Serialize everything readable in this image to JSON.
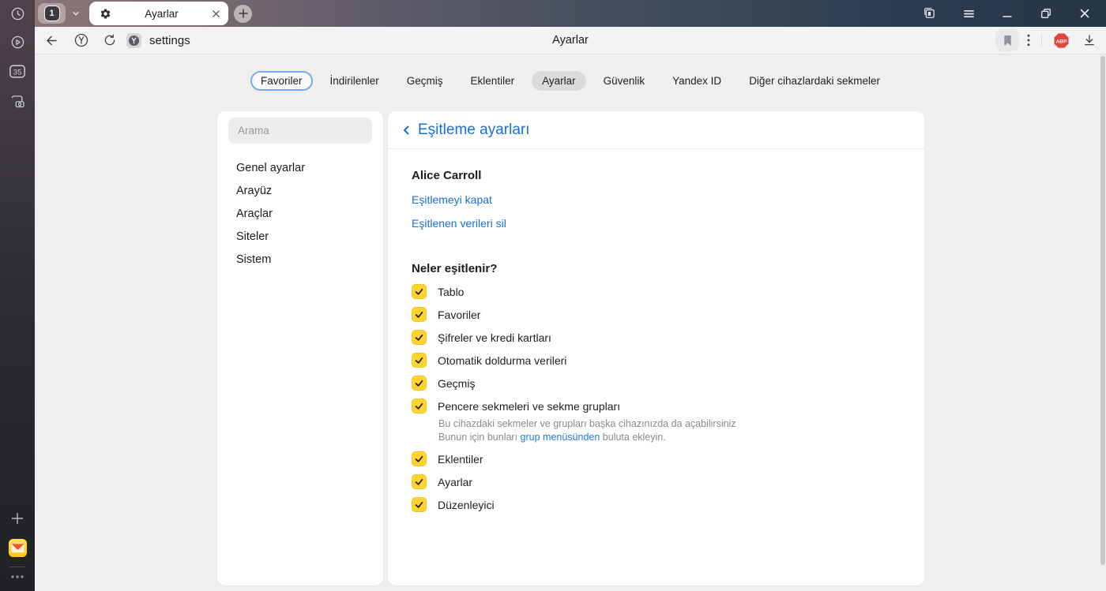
{
  "theme": {
    "accent_blue": "#1670d9",
    "checkbox_yellow": "#ffd42e",
    "abp_red": "#e2453c"
  },
  "rail": {
    "counter_badge": "35"
  },
  "tabstrip": {
    "group_count": "1",
    "tab_title": "Ayarlar"
  },
  "toolbar": {
    "url": "settings",
    "page_title": "Ayarlar",
    "adblock_badge": "ABP"
  },
  "nav_tabs": {
    "items": [
      {
        "label": "Favoriler",
        "state": "focused"
      },
      {
        "label": "İndirilenler",
        "state": ""
      },
      {
        "label": "Geçmiş",
        "state": ""
      },
      {
        "label": "Eklentiler",
        "state": ""
      },
      {
        "label": "Ayarlar",
        "state": "active"
      },
      {
        "label": "Güvenlik",
        "state": ""
      },
      {
        "label": "Yandex ID",
        "state": ""
      },
      {
        "label": "Diğer cihazlardaki sekmeler",
        "state": ""
      }
    ]
  },
  "settings_nav": {
    "search_placeholder": "Arama",
    "items": [
      "Genel ayarlar",
      "Arayüz",
      "Araçlar",
      "Siteler",
      "Sistem"
    ]
  },
  "sync": {
    "title": "Eşitleme ayarları",
    "account_name": "Alice Carroll",
    "action_links": [
      "Eşitlemeyi kapat",
      "Eşitlenen verileri sil"
    ],
    "section_title": "Neler eşitlenir?",
    "items": [
      {
        "label": "Tablo",
        "checked": true
      },
      {
        "label": "Favoriler",
        "checked": true
      },
      {
        "label": "Şifreler ve kredi kartları",
        "checked": true
      },
      {
        "label": "Otomatik doldurma verileri",
        "checked": true
      },
      {
        "label": "Geçmiş",
        "checked": true
      },
      {
        "label": "Pencere sekmeleri ve sekme grupları",
        "checked": true,
        "description_line1": "Bu cihazdaki sekmeler ve grupları başka cihazınızda da açabilirsiniz",
        "description_line2_prefix": "Bunun için bunları ",
        "description_line2_link": "grup menüsünden",
        "description_line2_suffix": " buluta ekleyin."
      },
      {
        "label": "Eklentiler",
        "checked": true
      },
      {
        "label": "Ayarlar",
        "checked": true
      },
      {
        "label": "Düzenleyici",
        "checked": true
      }
    ]
  }
}
